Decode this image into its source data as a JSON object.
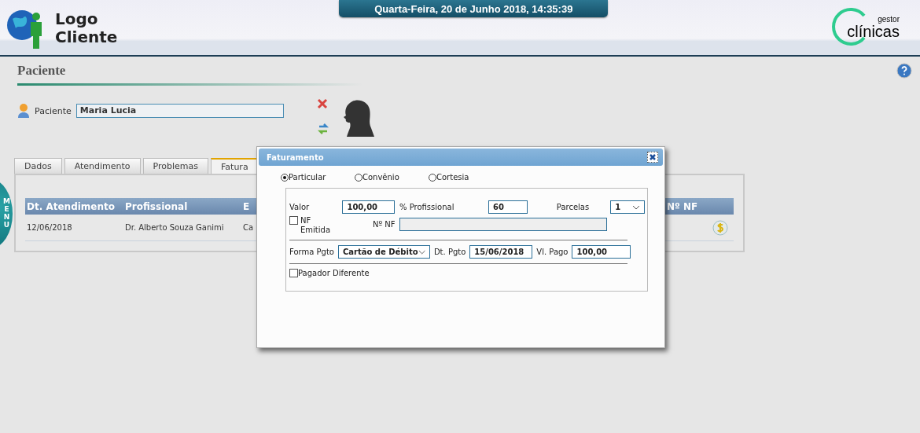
{
  "header": {
    "logo_text": [
      "Logo",
      "Cliente"
    ],
    "datetime": "Quarta-Feira, 20 de Junho 2018, 14:35:39",
    "brand_small": "gestor",
    "brand": "clínicas"
  },
  "page": {
    "title": "Paciente",
    "patient_label": "Paciente",
    "patient_value": "Maria Lucia"
  },
  "side_menu": "MENU",
  "tabs": [
    {
      "label": "Dados",
      "selected": false
    },
    {
      "label": "Atendimento",
      "selected": false
    },
    {
      "label": "Problemas",
      "selected": false
    },
    {
      "label": "Fatura",
      "selected": true
    }
  ],
  "table": {
    "columns": [
      "Dt. Atendimento",
      "Profissional",
      "E",
      "Nº NF"
    ],
    "rows": [
      {
        "cells": [
          "12/06/2018",
          "Dr. Alberto Souza Ganimi",
          "Ca"
        ]
      }
    ]
  },
  "dialog": {
    "title": "Faturamento",
    "payment_types": [
      {
        "label": "Particular",
        "selected": true
      },
      {
        "label": "Convênio",
        "selected": false
      },
      {
        "label": "Cortesia",
        "selected": false
      }
    ],
    "valor": {
      "label": "Valor",
      "value": "100,00"
    },
    "profissional": {
      "label": "% Profissional",
      "value": "60"
    },
    "parcelas": {
      "label": "Parcelas",
      "value": "1"
    },
    "nf_emitida": {
      "label": "NF Emitida",
      "checked": false
    },
    "nf_numero": {
      "label": "Nº NF",
      "disabled": true
    },
    "forma_pgto": {
      "label": "Forma Pgto",
      "value": "Cartão de Débito"
    },
    "dt_pgto": {
      "label": "Dt. Pgto",
      "value": "15/06/2018"
    },
    "vl_pago": {
      "label": "Vl. Pago",
      "value": "100,00"
    },
    "pagador_diferente": {
      "label": "Pagador Diferente",
      "checked": false
    }
  }
}
